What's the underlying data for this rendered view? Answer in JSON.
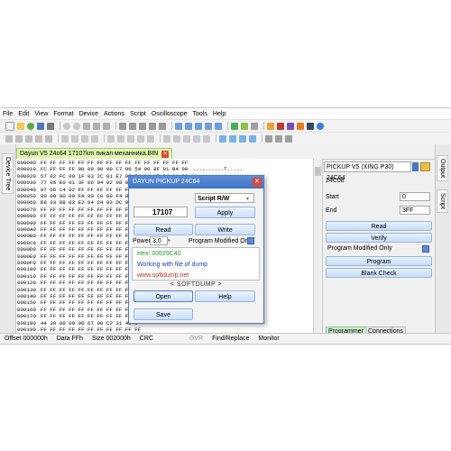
{
  "menu": [
    "File",
    "Edit",
    "View",
    "Format",
    "Device",
    "Actions",
    "Script",
    "Oscilloscope",
    "Tools",
    "Help"
  ],
  "left_tab": "Device Tree",
  "right_tabs": [
    "Output",
    "Script"
  ],
  "document_tab": "Dayun V5 24c64 17107km пикап механника.BIN",
  "hex_rows": [
    {
      "addr": "000000",
      "bytes": "FF FF FF FF FF FF FF FF FF FF FF FF FF FF FF FF",
      "ascii": ""
    },
    {
      "addr": "000010",
      "bytes": "FC FF FF FF 00 00 00 00 C7 00 54 00 8F 01 B4 00",
      "ascii": "..........T....."
    },
    {
      "addr": "000020",
      "bytes": "57 02 FC 00 1F 03 2C 01 E7 03 74 01 AF 04 A4 01",
      "ascii": "W.....,...t....."
    },
    {
      "addr": "000030",
      "bytes": "77 05 E0 01 3F 06 04 02 08 07 54",
      "ascii": ""
    },
    {
      "addr": "000040",
      "bytes": "97 06 C4 02 FF FF FF FF FF FF FF",
      "ascii": ""
    },
    {
      "addr": "000050",
      "bytes": "00 00 00 00 FA 00 C0 00 F4 01 5",
      "ascii": ""
    },
    {
      "addr": "000060",
      "bytes": "E8 03 88 02 E2 04 24 03 DC 05 C",
      "ascii": ""
    },
    {
      "addr": "000070",
      "bytes": "FF FF FF FF FF FF FF FF FF FF FF",
      "ascii": ""
    },
    {
      "addr": "000080",
      "bytes": "FF FF FF FF FF FF FF FF FF FF FF",
      "ascii": ""
    },
    {
      "addr": "000090",
      "bytes": "FF FF FF FF FF FF FF FF FF FF FF",
      "ascii": ""
    },
    {
      "addr": "0000A0",
      "bytes": "FF FF FF FF FF FF FF FF FF FF FF",
      "ascii": ""
    },
    {
      "addr": "0000B0",
      "bytes": "FF FF FF FF FF FF FF FF FF FF FF",
      "ascii": ""
    },
    {
      "addr": "0000C0",
      "bytes": "FF FF FF FF FF FF FF FF FF FF FF",
      "ascii": ""
    },
    {
      "addr": "0000D0",
      "bytes": "FF FF FF FF FF FF FF FF FF FF FF",
      "ascii": ""
    },
    {
      "addr": "0000E0",
      "bytes": "FF FF FF FF FF FF FF FF FF FF FF",
      "ascii": ""
    },
    {
      "addr": "0000F0",
      "bytes": "FF FF FF FF FF FF FF FF FF FF FF",
      "ascii": ""
    },
    {
      "addr": "000100",
      "bytes": "FF FF FF FF FF FF FF FF FF FF FF",
      "ascii": ""
    },
    {
      "addr": "000110",
      "bytes": "FF FF FF FF FF FF FF FF FF FF FF",
      "ascii": ""
    },
    {
      "addr": "000120",
      "bytes": "FF FF FF FF FF FF FF FF FF FF FF",
      "ascii": ""
    },
    {
      "addr": "000130",
      "bytes": "FF FF FF FF FF FF FF FF FF FF FF",
      "ascii": ""
    },
    {
      "addr": "000140",
      "bytes": "FF FF FF FF FF FF FF FF FF FF FF",
      "ascii": ""
    },
    {
      "addr": "000150",
      "bytes": "FF FF FF FF FF FF FF FF FF FF FF",
      "ascii": ""
    },
    {
      "addr": "000160",
      "bytes": "FF FF FF FF FF FF FF FF FF FF FF",
      "ascii": ""
    },
    {
      "addr": "000170",
      "bytes": "FF FF FF FF FF FF FF FF FF FF FF",
      "ascii": ""
    },
    {
      "addr": "000180",
      "bytes": "44 30 00 00 00 67 00 C2 31 43 0",
      "ascii": ""
    },
    {
      "addr": "000190",
      "bytes": "FF FF FF FF FF FF FF FF FF FF FF",
      "ascii": ""
    }
  ],
  "programmer": {
    "device": "PICKUP V5 (XING P30) 24C64",
    "chip": "24C08",
    "start_label": "Start",
    "start_value": "0",
    "end_label": "End",
    "end_value": "3FF",
    "read_label": "Read",
    "verify_label": "Verify",
    "modified_label": "Program Modified Only",
    "program_label": "Program",
    "blank_label": "Blank Check",
    "tabs": [
      "Programmer",
      "Connections"
    ]
  },
  "status": {
    "offset": "Offset 000000h",
    "data": "Data FFh",
    "size": "Size 002000h",
    "crc": "CRC",
    "ovr": "OVR",
    "find_replace": "Find/Replace",
    "monitor": "Monitor"
  },
  "dialog": {
    "title": "DAYUN PICKUP 24C64",
    "script_select": "Script R/W",
    "value": "17107",
    "apply_label": "Apply",
    "read_label": "Read",
    "write_label": "Write",
    "power_label": "Power",
    "power_value": "3,0",
    "modified_label": "Program Modified Onl",
    "hex_text": "Hex: 00029C40",
    "working_text": "Working with file of dump",
    "url_text": "www.softdump.net",
    "brand_text": "< SOFTDUMP >",
    "open_label": "Open",
    "help_label": "Help",
    "save_label": "Save"
  },
  "colors": {
    "accent": "#3f73c5",
    "green_tab": "#e2f3b0",
    "hex_green": "#1e9e2e",
    "text_blue": "#1b3fb8",
    "text_red": "#c03020"
  }
}
